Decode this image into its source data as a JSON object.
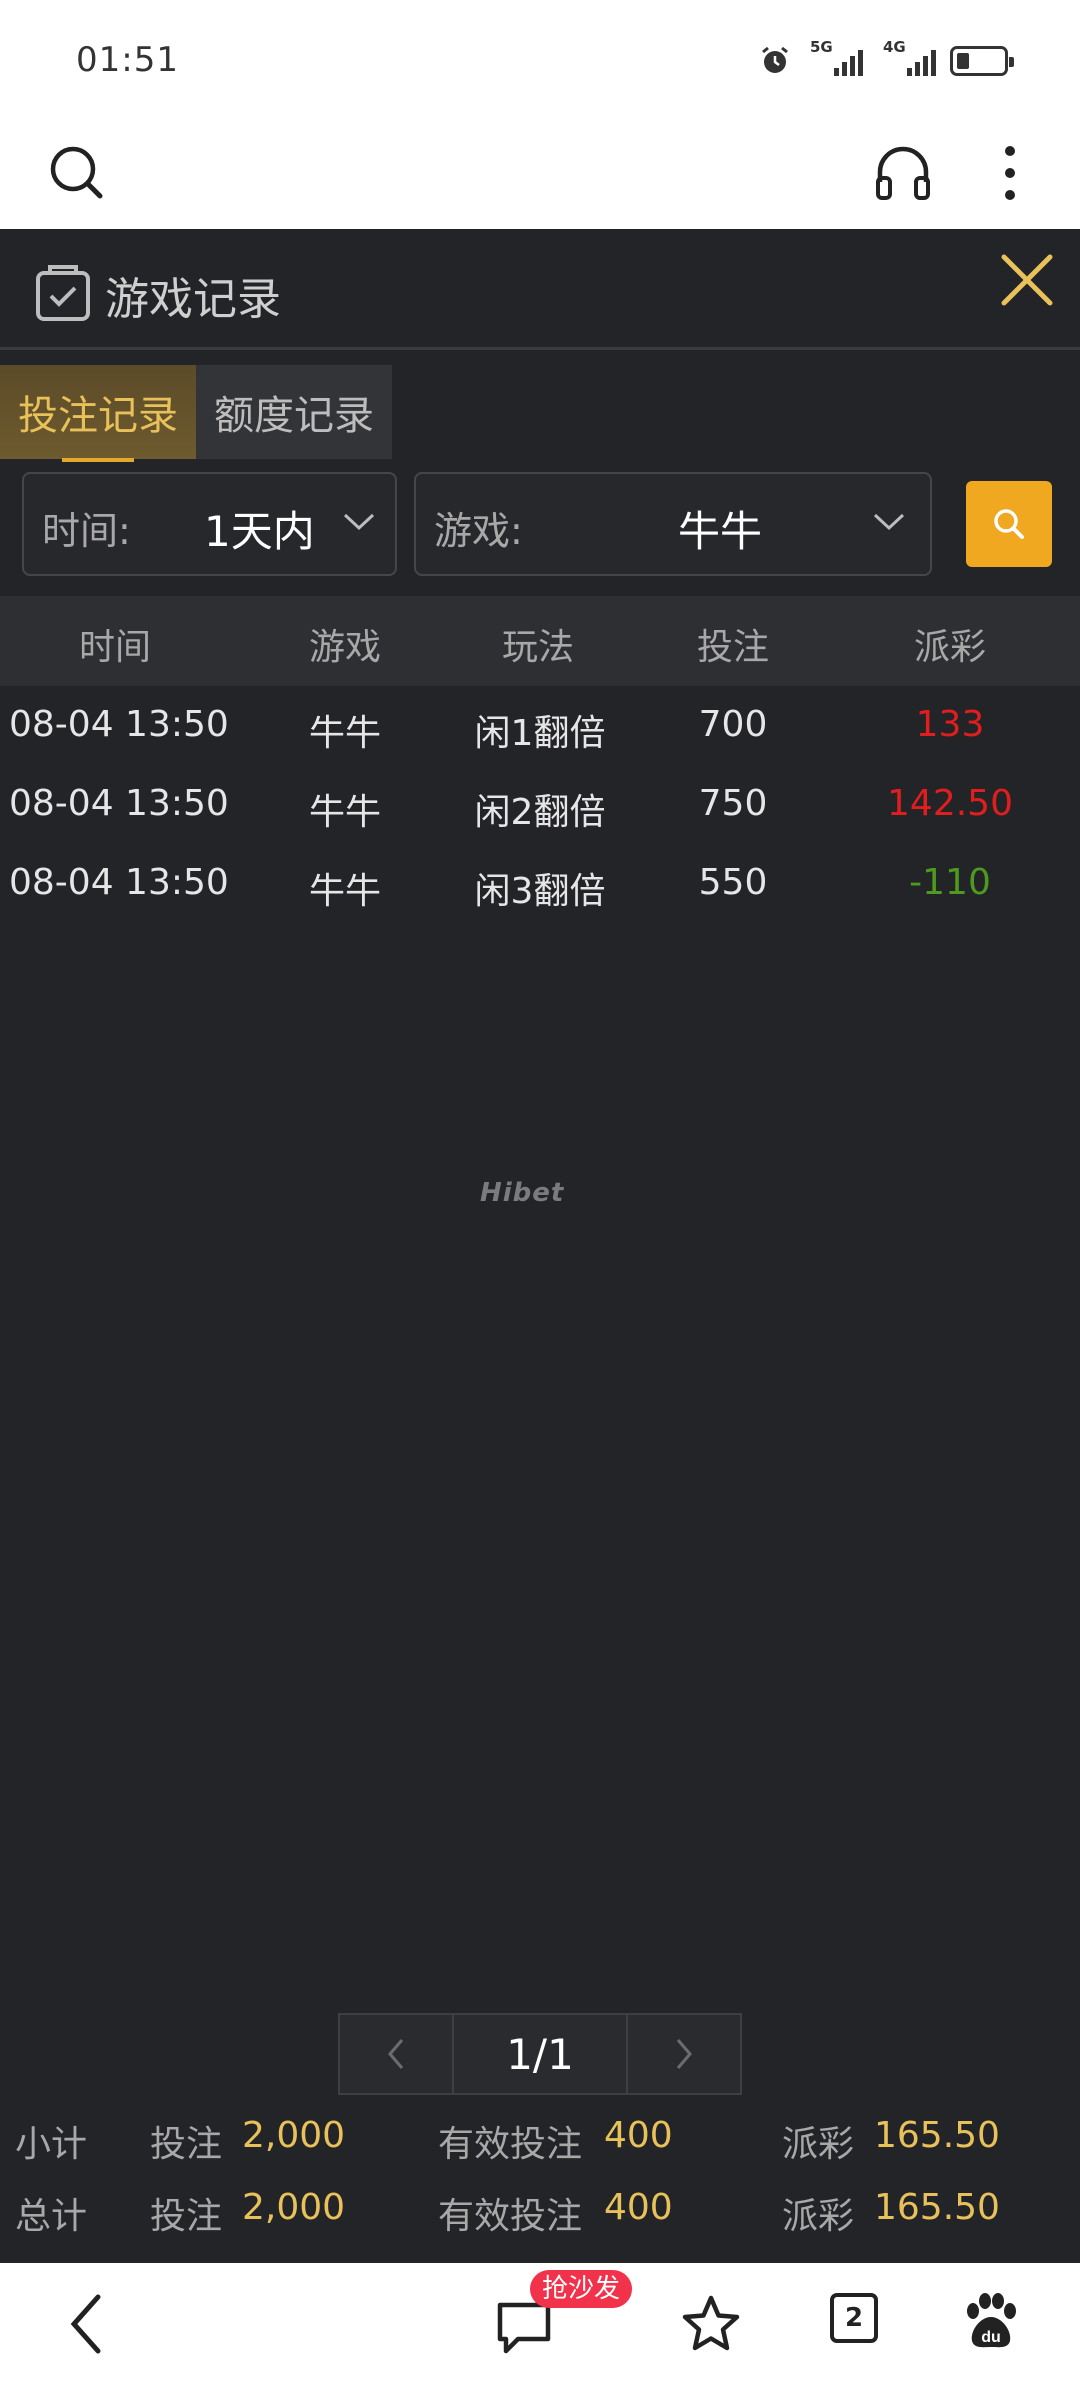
{
  "status_bar": {
    "time": "01:51",
    "net1": "5G",
    "net2": "4G"
  },
  "panel": {
    "title": "游戏记录",
    "close_icon": "close-icon"
  },
  "tabs": [
    {
      "label": "投注记录",
      "active": true
    },
    {
      "label": "额度记录",
      "active": false
    }
  ],
  "filters": {
    "time": {
      "label": "时间:",
      "value": "1天内"
    },
    "game": {
      "label": "游戏:",
      "value": "牛牛"
    }
  },
  "table": {
    "headers": [
      "时间",
      "游戏",
      "玩法",
      "投注",
      "派彩"
    ],
    "rows": [
      {
        "time": "08-04 13:50",
        "game": "牛牛",
        "play": "闲1翻倍",
        "bet": "700",
        "payout": "133",
        "payout_sign": "positive"
      },
      {
        "time": "08-04 13:50",
        "game": "牛牛",
        "play": "闲2翻倍",
        "bet": "750",
        "payout": "142.50",
        "payout_sign": "positive"
      },
      {
        "time": "08-04 13:50",
        "game": "牛牛",
        "play": "闲3翻倍",
        "bet": "550",
        "payout": "-110",
        "payout_sign": "negative"
      }
    ]
  },
  "watermark": "Hibet",
  "pager": {
    "current": "1/1"
  },
  "summary": {
    "subtotal": {
      "label": "小计",
      "bet_label": "投注",
      "bet": "2,000",
      "valid_label": "有效投注",
      "valid": "400",
      "payout_label": "派彩",
      "payout": "165.50"
    },
    "total": {
      "label": "总计",
      "bet_label": "投注",
      "bet": "2,000",
      "valid_label": "有效投注",
      "valid": "400",
      "payout_label": "派彩",
      "payout": "165.50"
    }
  },
  "bottom_nav": {
    "badge": "抢沙发",
    "tab_count": "2"
  },
  "colors": {
    "accent": "#efa81f",
    "gold_text": "#e9c15a",
    "panel_bg": "#232427",
    "positive": "#e01e1e",
    "negative": "#4d9a1e"
  }
}
